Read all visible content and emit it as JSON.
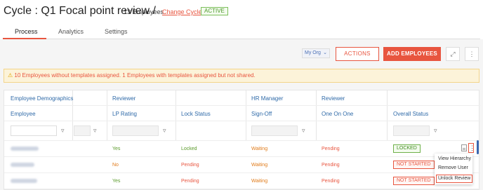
{
  "header": {
    "title": "Cycle : Q1 Focal point review /",
    "employees_count": "13 Employees",
    "change_cycle": "Change Cycle",
    "status": "ACTIVE"
  },
  "tabs": [
    {
      "label": "Process",
      "selected": true
    },
    {
      "label": "Analytics",
      "selected": false
    },
    {
      "label": "Settings",
      "selected": false
    }
  ],
  "toolbar": {
    "org_select": "My Org",
    "actions_label": "ACTIONS",
    "add_employees_label": "ADD EMPLOYEES",
    "expand_icon": "expand-icon",
    "more_icon": "more-vertical-icon"
  },
  "warning": {
    "text": "10 Employees without templates assigned.  1 Employees with templates assigned but not shared."
  },
  "table": {
    "group_headers": [
      "Employee Demographics",
      "Reviewer",
      "HR Manager",
      "Reviewer"
    ],
    "column_headers": [
      "Employee",
      "LP Rating",
      "Lock Status",
      "Sign-Off",
      "One On One",
      "Overall Status"
    ],
    "rows": [
      {
        "lp_rating": "Yes",
        "lock_status": "Locked",
        "sign_off": "Waiting",
        "one_on_one": "Pending",
        "overall_status": "LOCKED"
      },
      {
        "lp_rating": "No",
        "lock_status": "Pending",
        "sign_off": "Waiting",
        "one_on_one": "Pending",
        "overall_status": "NOT STARTED"
      },
      {
        "lp_rating": "Yes",
        "lock_status": "Pending",
        "sign_off": "Waiting",
        "one_on_one": "Pending",
        "overall_status": "NOT STARTED"
      }
    ]
  },
  "context_menu": {
    "items": [
      "View Hierarchy",
      "Remove User",
      "Unlock Review"
    ],
    "highlighted": "Unlock Review"
  },
  "colors": {
    "accent": "#e8553f",
    "link_blue": "#2f6aa8",
    "status_green": "#5a9a2a",
    "status_orange": "#e07b1a"
  }
}
